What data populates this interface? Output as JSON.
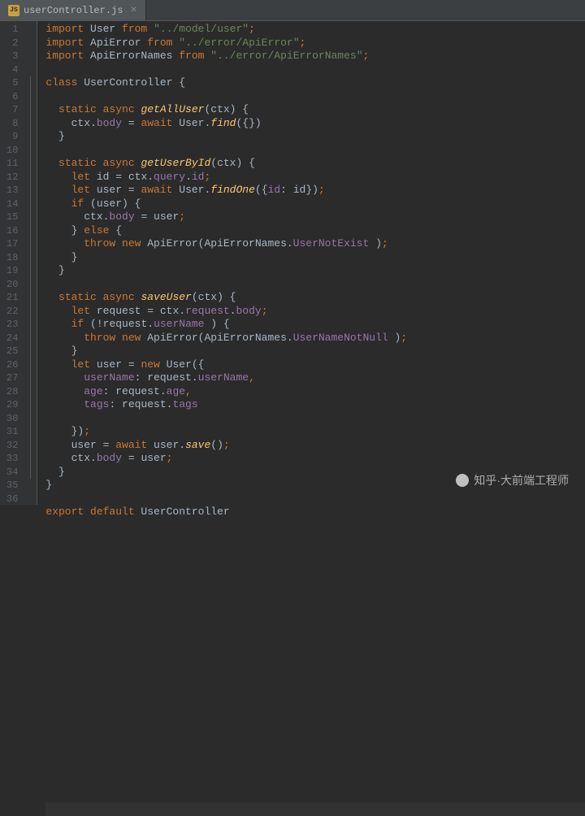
{
  "tab": {
    "filename": "userController.js",
    "icon_label": "JS"
  },
  "watermark": "知乎·大前端工程师",
  "lines": [
    {
      "n": 1,
      "t": [
        [
          "kw",
          "import"
        ],
        [
          "",
          " User "
        ],
        [
          "kw",
          "from"
        ],
        [
          "",
          " "
        ],
        [
          "str",
          "\"../model/user\""
        ],
        [
          "semi",
          ";"
        ]
      ]
    },
    {
      "n": 2,
      "t": [
        [
          "kw",
          "import"
        ],
        [
          "",
          " ApiError "
        ],
        [
          "kw",
          "from"
        ],
        [
          "",
          " "
        ],
        [
          "str",
          "\"../error/ApiError\""
        ],
        [
          "semi",
          ";"
        ]
      ]
    },
    {
      "n": 3,
      "t": [
        [
          "kw",
          "import"
        ],
        [
          "",
          " ApiErrorNames "
        ],
        [
          "kw",
          "from"
        ],
        [
          "",
          " "
        ],
        [
          "str",
          "\"../error/ApiErrorNames\""
        ],
        [
          "semi",
          ";"
        ]
      ]
    },
    {
      "n": 4,
      "t": [
        [
          "",
          ""
        ]
      ]
    },
    {
      "n": 5,
      "t": [
        [
          "kw",
          "class"
        ],
        [
          "",
          " UserController {"
        ]
      ]
    },
    {
      "n": 6,
      "t": [
        [
          "",
          ""
        ]
      ]
    },
    {
      "n": 7,
      "t": [
        [
          "",
          "  "
        ],
        [
          "kw",
          "static async"
        ],
        [
          "",
          " "
        ],
        [
          "fn",
          "getAllUser"
        ],
        [
          "",
          "(ctx) {"
        ]
      ]
    },
    {
      "n": 8,
      "t": [
        [
          "",
          "    ctx."
        ],
        [
          "field",
          "body"
        ],
        [
          "",
          " = "
        ],
        [
          "kw",
          "await"
        ],
        [
          "",
          " User."
        ],
        [
          "fn",
          "find"
        ],
        [
          "",
          "({})"
        ]
      ]
    },
    {
      "n": 9,
      "t": [
        [
          "",
          "  }"
        ]
      ]
    },
    {
      "n": 10,
      "t": [
        [
          "",
          ""
        ]
      ]
    },
    {
      "n": 11,
      "t": [
        [
          "",
          "  "
        ],
        [
          "kw",
          "static async"
        ],
        [
          "",
          " "
        ],
        [
          "fn",
          "getUserById"
        ],
        [
          "",
          "(ctx) {"
        ]
      ]
    },
    {
      "n": 12,
      "t": [
        [
          "",
          "    "
        ],
        [
          "kw",
          "let"
        ],
        [
          "",
          " id = ctx."
        ],
        [
          "field",
          "query"
        ],
        [
          "",
          "."
        ],
        [
          "field",
          "id"
        ],
        [
          "semi",
          ";"
        ]
      ]
    },
    {
      "n": 13,
      "t": [
        [
          "",
          "    "
        ],
        [
          "kw",
          "let"
        ],
        [
          "",
          " user = "
        ],
        [
          "kw",
          "await"
        ],
        [
          "",
          " User."
        ],
        [
          "fn",
          "findOne"
        ],
        [
          "",
          "({"
        ],
        [
          "field",
          "id"
        ],
        [
          "",
          ": id})"
        ],
        [
          "semi",
          ";"
        ]
      ]
    },
    {
      "n": 14,
      "t": [
        [
          "",
          "    "
        ],
        [
          "kw",
          "if"
        ],
        [
          "",
          " (user) {"
        ]
      ]
    },
    {
      "n": 15,
      "t": [
        [
          "",
          "      ctx."
        ],
        [
          "field",
          "body"
        ],
        [
          "",
          " = user"
        ],
        [
          "semi",
          ";"
        ]
      ]
    },
    {
      "n": 16,
      "t": [
        [
          "",
          "    } "
        ],
        [
          "kw",
          "else"
        ],
        [
          "",
          " {"
        ]
      ]
    },
    {
      "n": 17,
      "t": [
        [
          "",
          "      "
        ],
        [
          "kw",
          "throw new"
        ],
        [
          "",
          " ApiError(ApiErrorNames."
        ],
        [
          "field",
          "UserNotExist"
        ],
        [
          "",
          " )"
        ],
        [
          "semi",
          ";"
        ]
      ]
    },
    {
      "n": 18,
      "t": [
        [
          "",
          "    }"
        ]
      ]
    },
    {
      "n": 19,
      "t": [
        [
          "",
          "  }"
        ]
      ]
    },
    {
      "n": 20,
      "t": [
        [
          "",
          ""
        ]
      ]
    },
    {
      "n": 21,
      "t": [
        [
          "",
          "  "
        ],
        [
          "kw",
          "static async"
        ],
        [
          "",
          " "
        ],
        [
          "fn",
          "saveUser"
        ],
        [
          "",
          "(ctx) {"
        ]
      ]
    },
    {
      "n": 22,
      "t": [
        [
          "",
          "    "
        ],
        [
          "kw",
          "let"
        ],
        [
          "",
          " request = ctx."
        ],
        [
          "field",
          "request"
        ],
        [
          "",
          "."
        ],
        [
          "field",
          "body"
        ],
        [
          "semi",
          ";"
        ]
      ]
    },
    {
      "n": 23,
      "t": [
        [
          "",
          "    "
        ],
        [
          "kw",
          "if"
        ],
        [
          "",
          " (!request."
        ],
        [
          "field",
          "userName"
        ],
        [
          "",
          " ) {"
        ]
      ]
    },
    {
      "n": 24,
      "t": [
        [
          "",
          "      "
        ],
        [
          "kw",
          "throw new"
        ],
        [
          "",
          " ApiError(ApiErrorNames."
        ],
        [
          "field",
          "UserNameNotNull"
        ],
        [
          "",
          " )"
        ],
        [
          "semi",
          ";"
        ]
      ]
    },
    {
      "n": 25,
      "t": [
        [
          "",
          "    }"
        ]
      ]
    },
    {
      "n": 26,
      "t": [
        [
          "",
          "    "
        ],
        [
          "kw",
          "let"
        ],
        [
          "",
          " user = "
        ],
        [
          "kw",
          "new"
        ],
        [
          "",
          " User({"
        ]
      ]
    },
    {
      "n": 27,
      "t": [
        [
          "",
          "      "
        ],
        [
          "field",
          "userName"
        ],
        [
          "",
          ": request."
        ],
        [
          "field",
          "userName"
        ],
        [
          "semi",
          ","
        ]
      ]
    },
    {
      "n": 28,
      "t": [
        [
          "",
          "      "
        ],
        [
          "field",
          "age"
        ],
        [
          "",
          ": request."
        ],
        [
          "field",
          "age"
        ],
        [
          "semi",
          ","
        ]
      ]
    },
    {
      "n": 29,
      "t": [
        [
          "",
          "      "
        ],
        [
          "field",
          "tags"
        ],
        [
          "",
          ": request."
        ],
        [
          "field",
          "tags"
        ]
      ]
    },
    {
      "n": 30,
      "hl": true,
      "t": [
        [
          "",
          "    })"
        ],
        [
          "semi",
          ";"
        ]
      ]
    },
    {
      "n": 31,
      "t": [
        [
          "",
          "    user = "
        ],
        [
          "kw",
          "await"
        ],
        [
          "",
          " user."
        ],
        [
          "fn",
          "save"
        ],
        [
          "",
          "()"
        ],
        [
          "semi",
          ";"
        ]
      ]
    },
    {
      "n": 32,
      "t": [
        [
          "",
          "    ctx."
        ],
        [
          "field",
          "body"
        ],
        [
          "",
          " = user"
        ],
        [
          "semi",
          ";"
        ]
      ]
    },
    {
      "n": 33,
      "t": [
        [
          "",
          "  }"
        ]
      ]
    },
    {
      "n": 34,
      "t": [
        [
          "",
          "}"
        ]
      ]
    },
    {
      "n": 35,
      "t": [
        [
          "",
          ""
        ]
      ]
    },
    {
      "n": 36,
      "t": [
        [
          "kw",
          "export default"
        ],
        [
          "",
          " UserController"
        ]
      ]
    }
  ]
}
